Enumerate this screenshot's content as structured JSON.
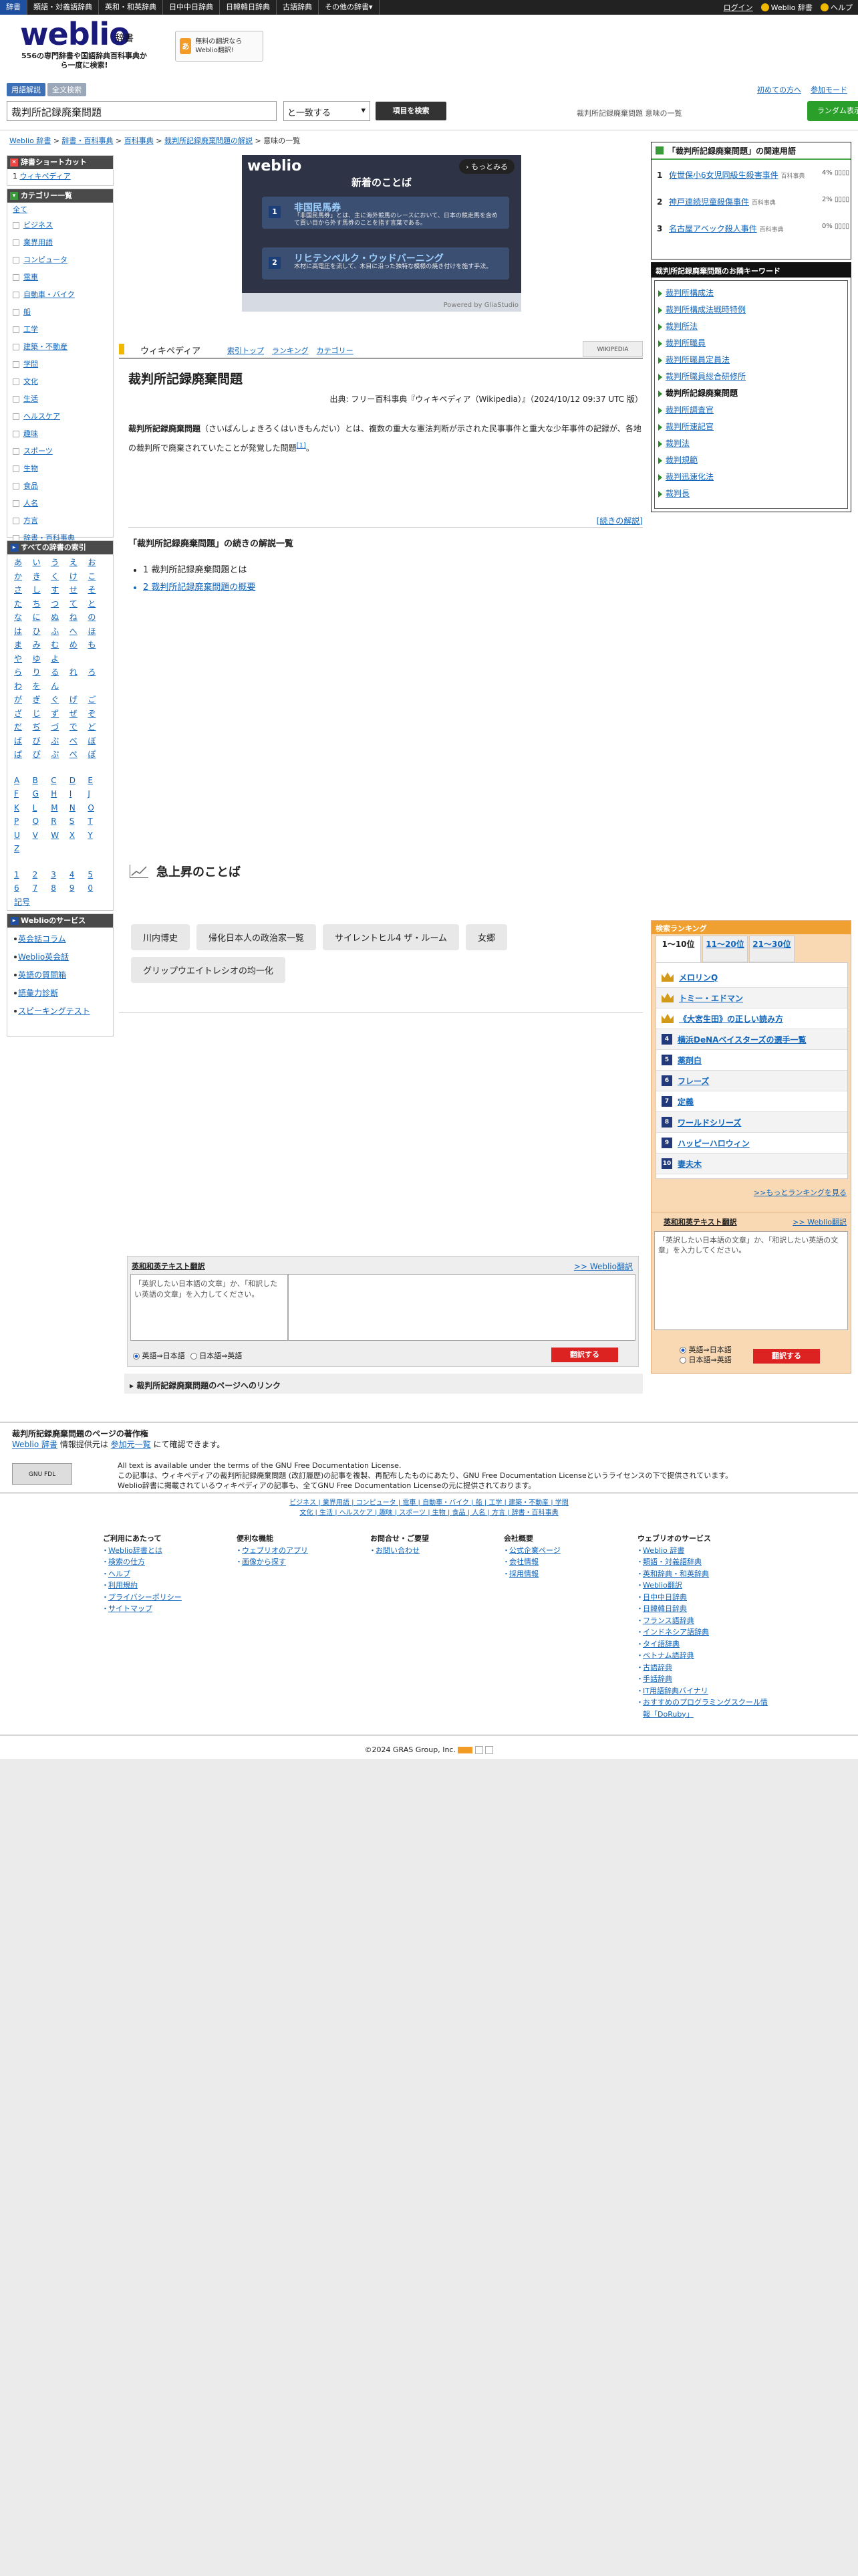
{
  "topbar": {
    "tabs": [
      "辞書",
      "類語・対義語辞典",
      "英和・和英辞典",
      "日中中日辞典",
      "日韓韓日辞典",
      "古語辞典",
      "その他の辞書▾"
    ],
    "right_links": [
      "ログイン",
      "Weblio 辞書",
      "ヘルプ"
    ]
  },
  "header": {
    "logo": "weblio",
    "logo_suffix": "辞書",
    "tagline": "556の専門辞書や国語辞典百科事典から一度に検索!",
    "promo_icon": "あ",
    "promo_text": "無料の翻訳なら Weblio翻訳!",
    "tabs": [
      "用語解説",
      "全文検索"
    ],
    "right_links": [
      "初めての方へ",
      "参加モード"
    ]
  },
  "search": {
    "query": "裁判所記録廃棄問題",
    "match_mode": "と一致する",
    "button": "項目を検索",
    "info": "裁判所記録廃棄問題 意味の一覧",
    "random_button": "ランダム表示"
  },
  "breadcrumb": [
    "Weblio 辞書",
    "辞書・百科事典",
    "百科事典",
    "裁判所記録廃棄問題の解説",
    "意味の一覧"
  ],
  "left": {
    "shortcut_head": "辞書ショートカット",
    "shortcut_items": [
      {
        "n": "1",
        "label": "ウィキペディア"
      }
    ],
    "category_head": "カテゴリー一覧",
    "category_all": "全て",
    "categories": [
      "ビジネス",
      "業界用語",
      "コンピュータ",
      "電車",
      "自動車・バイク",
      "船",
      "工学",
      "建築・不動産",
      "学問",
      "文化",
      "生活",
      "ヘルスケア",
      "趣味",
      "スポーツ",
      "生物",
      "食品",
      "人名",
      "方言",
      "辞書・百科事典"
    ],
    "kana_head": "すべての辞書の索引",
    "kana": [
      "あ",
      "い",
      "う",
      "え",
      "お",
      "か",
      "き",
      "く",
      "け",
      "こ",
      "さ",
      "し",
      "す",
      "せ",
      "そ",
      "た",
      "ち",
      "つ",
      "て",
      "と",
      "な",
      "に",
      "ぬ",
      "ね",
      "の",
      "は",
      "ひ",
      "ふ",
      "へ",
      "ほ",
      "ま",
      "み",
      "む",
      "め",
      "も",
      "や",
      "ゆ",
      "よ",
      "",
      "",
      "ら",
      "り",
      "る",
      "れ",
      "ろ",
      "わ",
      "を",
      "ん",
      "",
      "",
      "が",
      "ぎ",
      "ぐ",
      "げ",
      "ご",
      "ざ",
      "じ",
      "ず",
      "ぜ",
      "ぞ",
      "だ",
      "ぢ",
      "づ",
      "で",
      "ど",
      "ば",
      "び",
      "ぶ",
      "べ",
      "ぼ",
      "ぱ",
      "ぴ",
      "ぷ",
      "ぺ",
      "ぽ"
    ],
    "alpha": [
      "A",
      "B",
      "C",
      "D",
      "E",
      "F",
      "G",
      "H",
      "I",
      "J",
      "K",
      "L",
      "M",
      "N",
      "O",
      "P",
      "Q",
      "R",
      "S",
      "T",
      "U",
      "V",
      "W",
      "X",
      "Y",
      "Z"
    ],
    "digits": [
      "1",
      "2",
      "3",
      "4",
      "5",
      "6",
      "7",
      "8",
      "9",
      "0",
      "記号"
    ],
    "service_head": "Weblioのサービス",
    "services": [
      "英会話コラム",
      "Weblio英会話",
      "英語の質問箱",
      "語彙力診断",
      "スピーキングテスト"
    ]
  },
  "banner": {
    "brand": "weblio",
    "more": "もっとみる",
    "heading": "新着のことば",
    "items": [
      {
        "n": "1",
        "title": "非国民馬券",
        "desc": "「非国民馬券」とは、主に海外競馬のレースにおいて、日本の競走馬を含めて買い目から外す馬券のことを指す言葉である。"
      },
      {
        "n": "2",
        "title": "リヒテンベルク・ウッドバーニング",
        "desc": "木材に高電圧を流して、木目に沿った独特な模様の焼き付けを施す手法。"
      }
    ],
    "powered": "Powered by GliaStudio"
  },
  "entry": {
    "dict_name": "ウィキペディア",
    "dict_links": [
      "索引トップ",
      "ランキング",
      "カテゴリー"
    ],
    "dict_logo": "WIKIPEDIA",
    "title": "裁判所記録廃棄問題",
    "source": "出典: フリー百科事典『ウィキペディア（Wikipedia）』（2024/10/12 09:37 UTC 版）",
    "body_bold": "裁判所記録廃棄問題",
    "body_rest": "（さいばんしょきろくはいきもんだい）とは、複数の重大な憲法判断が示された民事事件と重大な少年事件の記録が、各地の裁判所で廃棄されていたことが発覚した問題",
    "ref": "[1]",
    "continue_link": "[続きの解説]",
    "cont_head": "「裁判所記録廃棄問題」の続きの解説一覧",
    "cont_items": [
      {
        "n": "1",
        "label": "裁判所記録廃棄問題とは",
        "link": false
      },
      {
        "n": "2",
        "label": "裁判所記録廃棄問題の概要",
        "link": true
      }
    ]
  },
  "trending": {
    "title": "急上昇のことば",
    "chips": [
      "川内博史",
      "帰化日本人の政治家一覧",
      "サイレントヒル4 ザ・ルーム",
      "女郷",
      "グリップウエイトレシオの均一化"
    ]
  },
  "translate_center": {
    "head": "英和和英テキスト翻訳",
    "link": ">> Weblio翻訳",
    "placeholder": "「英訳したい日本語の文章」か、「和訳したい英語の文章」を入力してください。",
    "radio1": "英語⇒日本語",
    "radio2": "日本語⇒英語",
    "button": "翻訳する"
  },
  "pagelink": "裁判所記録廃棄問題のページへのリンク",
  "right": {
    "related_head": "「裁判所記録廃棄問題」の関連用語",
    "related": [
      {
        "n": "1",
        "term": "佐世保小6女児同級生殺害事件",
        "cat": "百科事典",
        "pct": "4%"
      },
      {
        "n": "2",
        "term": "神戸連続児童殺傷事件",
        "cat": "百科事典",
        "pct": "2%"
      },
      {
        "n": "3",
        "term": "名古屋アベック殺人事件",
        "cat": "百科事典",
        "pct": "0%"
      }
    ],
    "kw_head": "裁判所記録廃棄問題のお隣キーワード",
    "keywords": [
      "裁判所構成法",
      "裁判所構成法戦時特例",
      "裁判所法",
      "裁判所職員",
      "裁判所職員定員法",
      "裁判所職員総合研修所",
      "裁判所記録廃棄問題",
      "裁判所調査官",
      "裁判所速記官",
      "裁判法",
      "裁判規範",
      "裁判迅速化法",
      "裁判長"
    ],
    "kw_current": "裁判所記録廃棄問題",
    "rank_head": "検索ランキング",
    "rank_tabs": [
      "1〜10位",
      "11〜20位",
      "21〜30位"
    ],
    "ranks": [
      {
        "n": "1",
        "label": "メロリンQ"
      },
      {
        "n": "2",
        "label": "トミー・エドマン"
      },
      {
        "n": "3",
        "label": "《大宮生田》の正しい読み方"
      },
      {
        "n": "4",
        "label": "横浜DeNAベイスターズの選手一覧"
      },
      {
        "n": "5",
        "label": "薬剤白"
      },
      {
        "n": "6",
        "label": "フレーズ"
      },
      {
        "n": "7",
        "label": "定義"
      },
      {
        "n": "8",
        "label": "ワールドシリーズ"
      },
      {
        "n": "9",
        "label": "ハッピーハロウィン"
      },
      {
        "n": "10",
        "label": "妻夫木"
      }
    ],
    "rank_more": ">>もっとランキングを見る",
    "tr_head": "英和和英テキスト翻訳",
    "tr_link": ">> Weblio翻訳",
    "tr_placeholder": "「英訳したい日本語の文章」か、「和訳したい英語の文章」を入力してください。",
    "tr_radio1": "英語⇒日本語",
    "tr_radio2": "日本語⇒英語",
    "tr_button": "翻訳する"
  },
  "footer": {
    "copy_head": "裁判所記録廃棄問題のページの著作権",
    "copy_line_a": "Weblio 辞書",
    "copy_line_b": " 情報提供元は ",
    "copy_line_c": "参加元一覧",
    "copy_line_d": " にて確認できます。",
    "gfdl": "GNU FDL",
    "license1": "All text is available under the terms of the GNU Free Documentation License.",
    "license2": "この記事は、ウィキペディアの裁判所記録廃棄問題 (改訂履歴)の記事を複製、再配布したものにあたり、GNU Free Documentation Licenseというライセンスの下で提供されています。",
    "license3": "Weblio辞書に掲載されているウィキペディアの記事も、全てGNU Free Documentation Licenseの元に提供されております。",
    "nav1": "ビジネス | 業界用語 | コンピュータ | 電車 | 自動車・バイク | 船 | 工学 | 建築・不動産 | 学問",
    "nav2": "文化 | 生活 | ヘルスケア | 趣味 | スポーツ | 生物 | 食品 | 人名 | 方言 | 辞書・百科事典",
    "cols": [
      {
        "head": "ご利用にあたって",
        "items": [
          "Weblio辞書とは",
          "検索の仕方",
          "ヘルプ",
          "利用規約",
          "プライバシーポリシー",
          "サイトマップ"
        ]
      },
      {
        "head": "便利な機能",
        "items": [
          "ウェブリオのアプリ",
          "画像から探す"
        ]
      },
      {
        "head": "お問合せ・ご要望",
        "items": [
          "お問い合わせ"
        ]
      },
      {
        "head": "会社概要",
        "items": [
          "公式企業ページ",
          "会社情報",
          "採用情報"
        ]
      },
      {
        "head": "ウェブリオのサービス",
        "items": [
          "Weblio 辞書",
          "類語・対義語辞典",
          "英和辞典・和英辞典",
          "Weblio翻訳",
          "日中中日辞典",
          "日韓韓日辞典",
          "フランス語辞典",
          "インドネシア語辞典",
          "タイ語辞典",
          "ベトナム語辞典",
          "古語辞典",
          "手話辞典",
          "IT用語辞典バイナリ",
          "おすすめのプログラミングスクール情報「DoRuby」"
        ]
      }
    ],
    "copyright": "©2024 GRAS Group, Inc."
  }
}
